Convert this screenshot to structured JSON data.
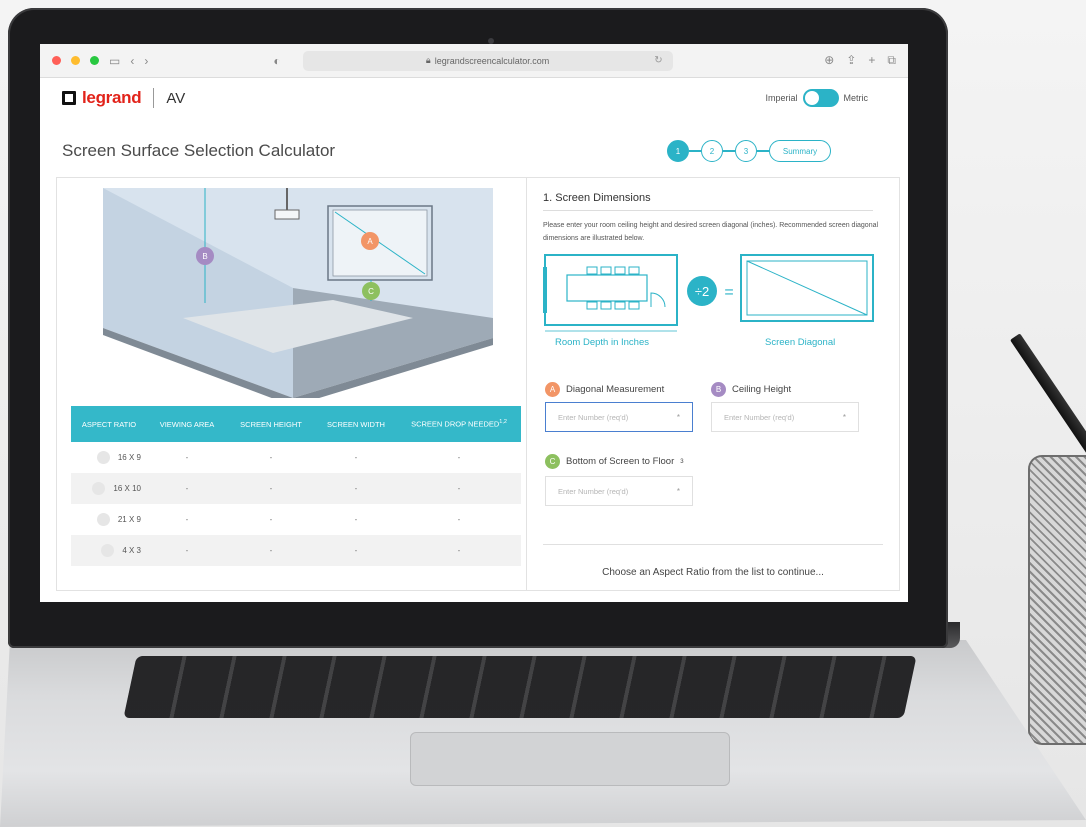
{
  "browser": {
    "url": "legrandscreencalculator.com"
  },
  "header": {
    "brand": "legrand",
    "product": "AV",
    "unit_left": "Imperial",
    "unit_right": "Metric"
  },
  "page": {
    "title": "Screen Surface Selection Calculator",
    "steps": [
      "1",
      "2",
      "3"
    ],
    "summary_label": "Summary"
  },
  "diagram": {
    "label_a": "A",
    "label_b": "B",
    "label_c": "C"
  },
  "table": {
    "headers": [
      "ASPECT RATIO",
      "VIEWING AREA",
      "SCREEN HEIGHT",
      "SCREEN WIDTH",
      "SCREEN DROP NEEDED"
    ],
    "header_sup": "1,2",
    "rows": [
      {
        "ratio": "16 X 9",
        "viewing": "-",
        "height": "-",
        "width": "-",
        "drop": "-"
      },
      {
        "ratio": "16 X 10",
        "viewing": "-",
        "height": "-",
        "width": "-",
        "drop": "-"
      },
      {
        "ratio": "21 X 9",
        "viewing": "-",
        "height": "-",
        "width": "-",
        "drop": "-"
      },
      {
        "ratio": "4 X 3",
        "viewing": "-",
        "height": "-",
        "width": "-",
        "drop": "-"
      }
    ]
  },
  "panel": {
    "section_title": "1. Screen Dimensions",
    "instructions": "Please enter your room ceiling height and desired screen diagonal (inches). Recommended screen diagonal dimensions are illustrated below.",
    "divide_label": "÷2",
    "equals": "=",
    "room_depth_label": "Room Depth in Inches",
    "screen_diagonal_label": "Screen Diagonal",
    "diag_label": "Diagonal Measurement",
    "ceiling_label": "Ceiling Height",
    "bottom_label": "Bottom of Screen to Floor",
    "bottom_sup": "3",
    "placeholder": "Enter Number (req'd)",
    "req_mark": "*",
    "continue_text": "Choose an Aspect Ratio from the list to continue..."
  },
  "colors": {
    "accent": "#2bb3c7",
    "badge_a": "#f29566",
    "badge_b": "#a58bc3",
    "badge_c": "#8dc05f",
    "brand_red": "#e2231a"
  }
}
